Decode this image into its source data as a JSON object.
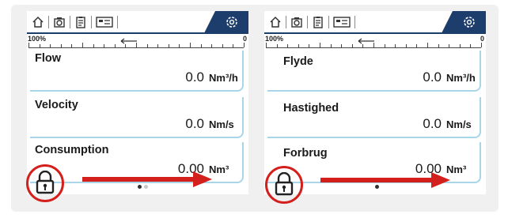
{
  "colors": {
    "accent": "#1d3d6d",
    "row_border": "#a9d5e8",
    "highlight_red": "#d4201c"
  },
  "topbar": {
    "icons": [
      "home-icon",
      "camera-icon",
      "document-icon",
      "card-icon"
    ],
    "settings_icon": "gear-icon"
  },
  "scale": {
    "left_label": "100%",
    "right_label": "0",
    "direction_icon": "left-arrow-icon"
  },
  "panel_left": {
    "rows": [
      {
        "label": "Flow",
        "value": "0.0",
        "unit": "Nm³/h"
      },
      {
        "label": "Velocity",
        "value": "0.0",
        "unit": "Nm/s"
      },
      {
        "label": "Consumption",
        "value": "0.00",
        "unit": "Nm³"
      }
    ],
    "page_indicator": {
      "pages": 2,
      "current": 1
    }
  },
  "panel_right": {
    "rows": [
      {
        "label": "Flyde",
        "value": "0.0",
        "unit": "Nm³/h"
      },
      {
        "label": "Hastighed",
        "value": "0.0",
        "unit": "Nm/s"
      },
      {
        "label": "Forbrug",
        "value": "0.00",
        "unit": "Nm³"
      }
    ],
    "page_indicator": {
      "pages": 1,
      "current": 1
    }
  },
  "overlay": {
    "lock_icon": "lock-icon",
    "arrow_icon": "red-arrow-icon"
  }
}
